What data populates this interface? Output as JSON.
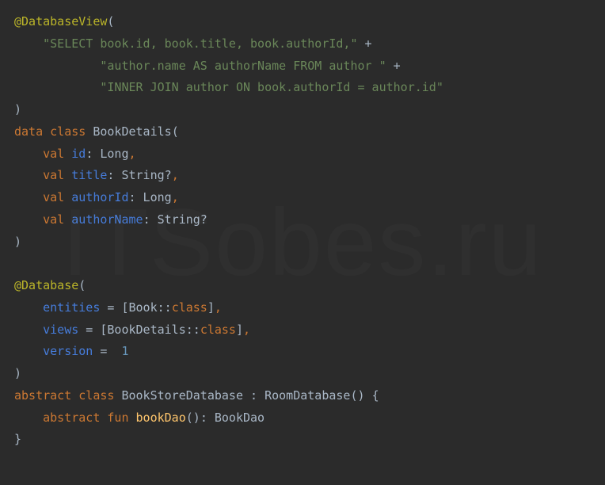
{
  "watermark": "ITSobes.ru",
  "code": {
    "ann1": {
      "at": "@",
      "name": "DatabaseView",
      "open": "("
    },
    "s1a": "\"SELECT book.id, book.title, book.authorId,\"",
    "plus": " +",
    "s1b": "\"author.name AS authorName FROM author \"",
    "s1c": "\"INNER JOIN author ON book.authorId = author.id\"",
    "close": ")",
    "kw_data": "data",
    "kw_class": "class",
    "cls_book": " BookDetails",
    "open2": "(",
    "kw_val": "val",
    "f_id": " id",
    "t_long": " Long",
    "f_title": " title",
    "t_string": " String?",
    "f_authorId": " authorId",
    "f_authorName": " authorName",
    "colon": ":",
    "comma": ",",
    "ann2": {
      "at": "@",
      "name": "Database",
      "open": "("
    },
    "p_entities": "entities",
    "eq": " = ",
    "b_open": "[",
    "cls_Book": "Book",
    "dcolon": "::",
    "kw_classref": "class",
    "b_close": "]",
    "p_views": "views",
    "cls_BookDetails": "BookDetails",
    "p_version": "version",
    "n_one": " 1",
    "kw_abstract": "abstract",
    "cls_store": " BookStoreDatabase ",
    "cls_room": " RoomDatabase",
    "brace_open": "{",
    "brace_close": "}",
    "paren_pair": "()",
    "kw_fun": "fun",
    "fn_bookDao": " bookDao",
    "t_bookDao": " BookDao"
  }
}
